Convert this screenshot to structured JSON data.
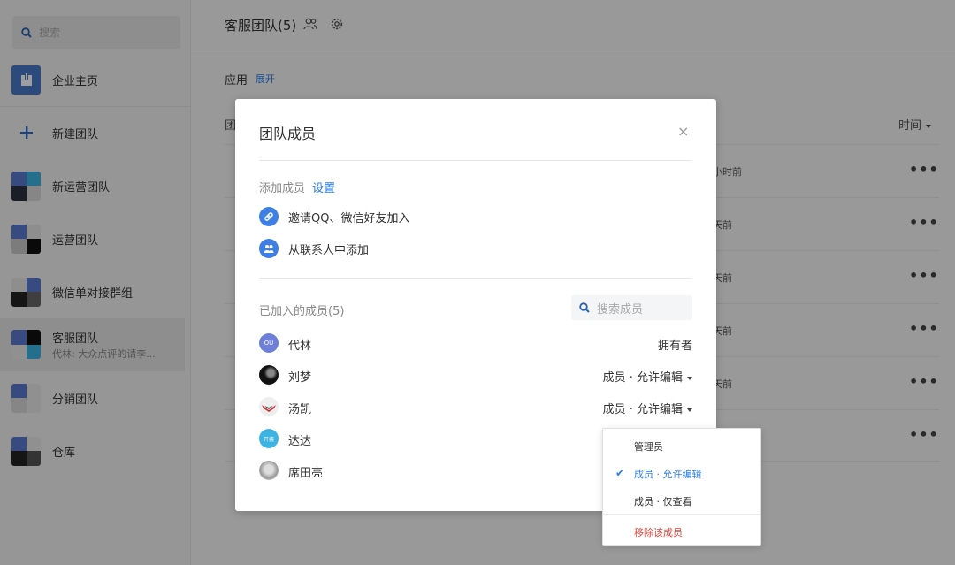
{
  "sidebar": {
    "search_placeholder": "搜索",
    "items": [
      {
        "label": "企业主页"
      },
      {
        "label": "新建团队"
      },
      {
        "label": "新运营团队"
      },
      {
        "label": "运营团队"
      },
      {
        "label": "微信单对接群组"
      },
      {
        "label": "客服团队",
        "sub": "代林: 大众点评的请李..."
      },
      {
        "label": "分销团队"
      },
      {
        "label": "仓库"
      }
    ]
  },
  "header": {
    "team_title": "客服团队(5)",
    "apps_label": "应用",
    "apps_expand": "展开",
    "team_col": "团",
    "time_col": "时间"
  },
  "rows": [
    {
      "time": "小时前"
    },
    {
      "time": "天前"
    },
    {
      "time": "天前"
    },
    {
      "time": "天前"
    },
    {
      "time": "天前"
    },
    {
      "time": ""
    }
  ],
  "more_glyph": "•••",
  "modal": {
    "title": "团队成员",
    "close": "×",
    "add_label": "添加成员",
    "settings": "设置",
    "invite": "邀请QQ、微信好友加入",
    "from_contacts": "从联系人中添加",
    "joined_label": "已加入的成员(5)",
    "search_placeholder": "搜索成员",
    "members": [
      {
        "name": "代林",
        "role": "拥有者"
      },
      {
        "name": "刘梦",
        "role": "成员 · 允许编辑"
      },
      {
        "name": "汤凯",
        "role": "成员 · 允许编辑"
      },
      {
        "name": "达达",
        "role": ""
      },
      {
        "name": "席田亮",
        "role": ""
      }
    ],
    "avatar_text": {
      "ou": "OU",
      "kai": "开酱"
    }
  },
  "dropdown": {
    "items": [
      {
        "label": "管理员"
      },
      {
        "label": "成员 · 允许编辑",
        "selected": true
      },
      {
        "label": "成员 · 仅查看"
      },
      {
        "label": "移除该成员",
        "danger": true
      }
    ]
  },
  "colors": {
    "accent": "#2b7de9",
    "danger": "#e9483f",
    "icon_blue": "#3d7fe5"
  }
}
